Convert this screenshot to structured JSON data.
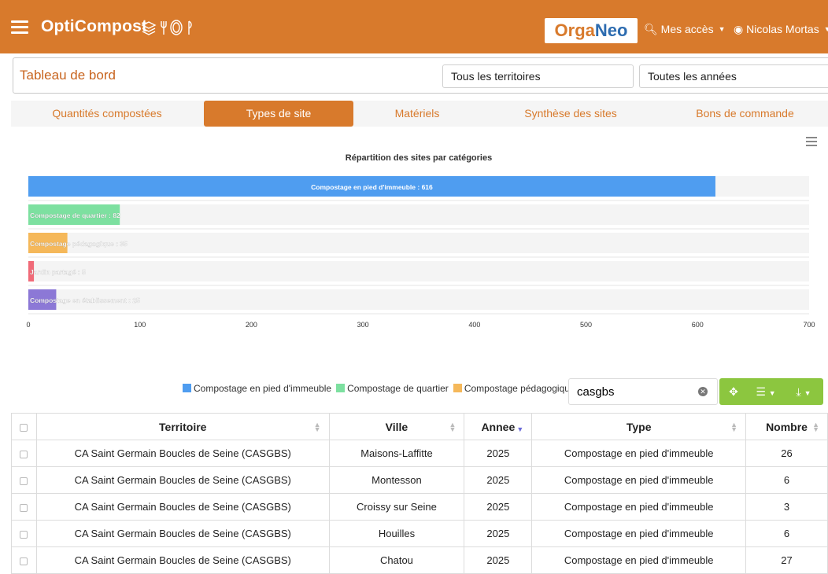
{
  "header": {
    "brand": "OptiCompost",
    "logo_part1": "Orga",
    "logo_part2": "Neo",
    "access_menu": "Mes accès",
    "user_menu": "Nicolas Mortas"
  },
  "filters": {
    "page_title": "Tableau de bord",
    "territory": "Tous les territoires",
    "year": "Toutes les années"
  },
  "tabs": [
    {
      "label": "Quantités compostées"
    },
    {
      "label": "Types de site"
    },
    {
      "label": "Matériels"
    },
    {
      "label": "Synthèse des sites"
    },
    {
      "label": "Bons de commande"
    }
  ],
  "chart_data": {
    "type": "bar",
    "orientation": "horizontal",
    "title": "Répartition des sites par catégories",
    "categories": [
      "Compostage en pied d'immeuble",
      "Compostage de quartier",
      "Compostage pédagogique",
      "Jardin partagé",
      "Compostage en établissement"
    ],
    "values": [
      616,
      82,
      35,
      5,
      25
    ],
    "labels": [
      "Compostage en pied d'immeuble : 616",
      "Compostage de quartier : 82",
      "Compostage pédagogique : 35",
      "Jardin partagé : 5",
      "Compostage en établissement : 25"
    ],
    "colors": [
      "#4f9df0",
      "#7de0a0",
      "#f5b85a",
      "#f06a78",
      "#8c78d6"
    ],
    "xlim": [
      0,
      700
    ],
    "xticks": [
      "0",
      "100",
      "200",
      "300",
      "400",
      "500",
      "600",
      "700"
    ],
    "legend_position": "bottom",
    "legend": [
      "Compostage en pied d'immeuble",
      "Compostage de quartier",
      "Compostage pédagogique"
    ]
  },
  "table_toolbar": {
    "search_value": "casgbs"
  },
  "table": {
    "columns": [
      "Territoire",
      "Ville",
      "Annee",
      "Type",
      "Nombre"
    ],
    "rows": [
      [
        "CA Saint Germain Boucles de Seine (CASGBS)",
        "Maisons-Laffitte",
        "2025",
        "Compostage en pied d'immeuble",
        "26"
      ],
      [
        "CA Saint Germain Boucles de Seine (CASGBS)",
        "Montesson",
        "2025",
        "Compostage en pied d'immeuble",
        "6"
      ],
      [
        "CA Saint Germain Boucles de Seine (CASGBS)",
        "Croissy sur Seine",
        "2025",
        "Compostage en pied d'immeuble",
        "3"
      ],
      [
        "CA Saint Germain Boucles de Seine (CASGBS)",
        "Houilles",
        "2025",
        "Compostage en pied d'immeuble",
        "6"
      ],
      [
        "CA Saint Germain Boucles de Seine (CASGBS)",
        "Chatou",
        "2025",
        "Compostage en pied d'immeuble",
        "27"
      ]
    ]
  }
}
